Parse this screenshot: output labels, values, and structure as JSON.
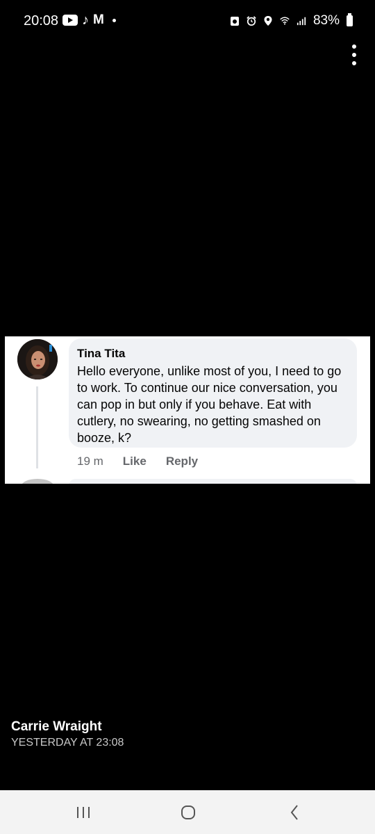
{
  "status_bar": {
    "time": "20:08",
    "notification_icons": [
      "youtube-icon",
      "tiktok-icon",
      "gmail-icon",
      "dot-icon"
    ],
    "system_icons": [
      "clipboard-icon",
      "alarm-icon",
      "location-icon",
      "wifi-icon",
      "signal-icon"
    ],
    "battery": "83%"
  },
  "comment": {
    "author": "Tina Tita",
    "text": "Hello everyone, unlike most of you, I need to go to work. To continue our nice conversation, you can pop in but only if you behave. Eat with cutlery, no swearing, no getting smashed on booze, k?",
    "time": "19 m",
    "like_label": "Like",
    "reply_label": "Reply"
  },
  "post": {
    "poster_name": "Carrie Wraight",
    "poster_time": "YESTERDAY AT 23:08"
  },
  "nav": {
    "buttons": [
      "recents-icon",
      "home-icon",
      "back-icon"
    ]
  },
  "colors": {
    "bubble_bg": "#f0f2f5",
    "meta_text": "#65676b",
    "nav_bg": "#f3f3f3"
  }
}
